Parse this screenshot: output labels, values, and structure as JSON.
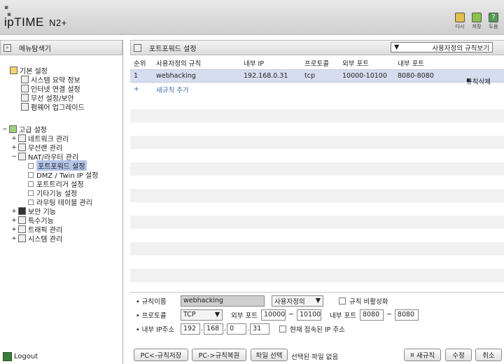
{
  "header": {
    "logo_main": "ipTIME",
    "logo_model": "N2+",
    "buttons": [
      "다시",
      "저장",
      "도움"
    ]
  },
  "sidebar": {
    "title": "메뉴탐색기",
    "basic": {
      "label": "기본 설정",
      "items": [
        "시스템 요약 정보",
        "인터넷 연결 설정",
        "무선 설정/보안",
        "펌웨어 업그레이드"
      ]
    },
    "advanced": {
      "label": "고급 설정",
      "network": "네트워크 관리",
      "wireless": "무선랜 관리",
      "nat": "NAT/라우터 관리",
      "nat_items": [
        "포트포워드 설정",
        "DMZ / Twin IP 설정",
        "포트트리거 설정",
        "기타기능 설정",
        "라우팅 테이블 관리"
      ],
      "security": "보안 기능",
      "special": "특수기능",
      "traffic": "트래픽 관리",
      "system": "시스템 관리"
    },
    "logout": "Logout"
  },
  "main": {
    "title": "포트포워드 설정",
    "view_select": "사용자정의 규칙보기",
    "columns": [
      "순위",
      "사용자정의 규칙",
      "내부 IP",
      "프로토콜",
      "외부 포트",
      "내부 포트"
    ],
    "rules": [
      {
        "rank": "1",
        "name": "webhacking",
        "ip": "192.168.0.31",
        "protocol": "tcp",
        "ext_port": "10000-10100",
        "int_port": "8080-8080",
        "delete": "규칙삭제"
      }
    ],
    "add_icon": "+",
    "add_label": "새규칙 추가"
  },
  "form": {
    "rule_name_label": "규칙이름",
    "rule_name_value": "webhacking",
    "rule_type": "사용자정의",
    "disable_label": "규칙 비활성화",
    "protocol_label": "프로토콜",
    "protocol_value": "TCP",
    "ext_port_label": "외부 포트",
    "ext_port_from": "10000",
    "ext_port_to": "10100",
    "int_port_label": "내부 포트",
    "int_port_from": "8080",
    "int_port_to": "8080",
    "ip_label": "내부 IP주소",
    "ip": [
      "192",
      "168",
      "0",
      "31"
    ],
    "current_ip_label": "현재 접속된 IP 주소",
    "tilde": "~"
  },
  "buttons": {
    "pc_save": "PC<-규칙저장",
    "pc_restore": "PC->규칙복원",
    "file_select": "파일 선택",
    "no_file": "선택된 파일 없음",
    "new_rule": "새규칙",
    "modify": "수정",
    "cancel": "취소"
  },
  "colors": {
    "selected_row": "#d6ddef",
    "selected_tree": "#b4c5e8",
    "add_link": "#4a6fb5"
  }
}
